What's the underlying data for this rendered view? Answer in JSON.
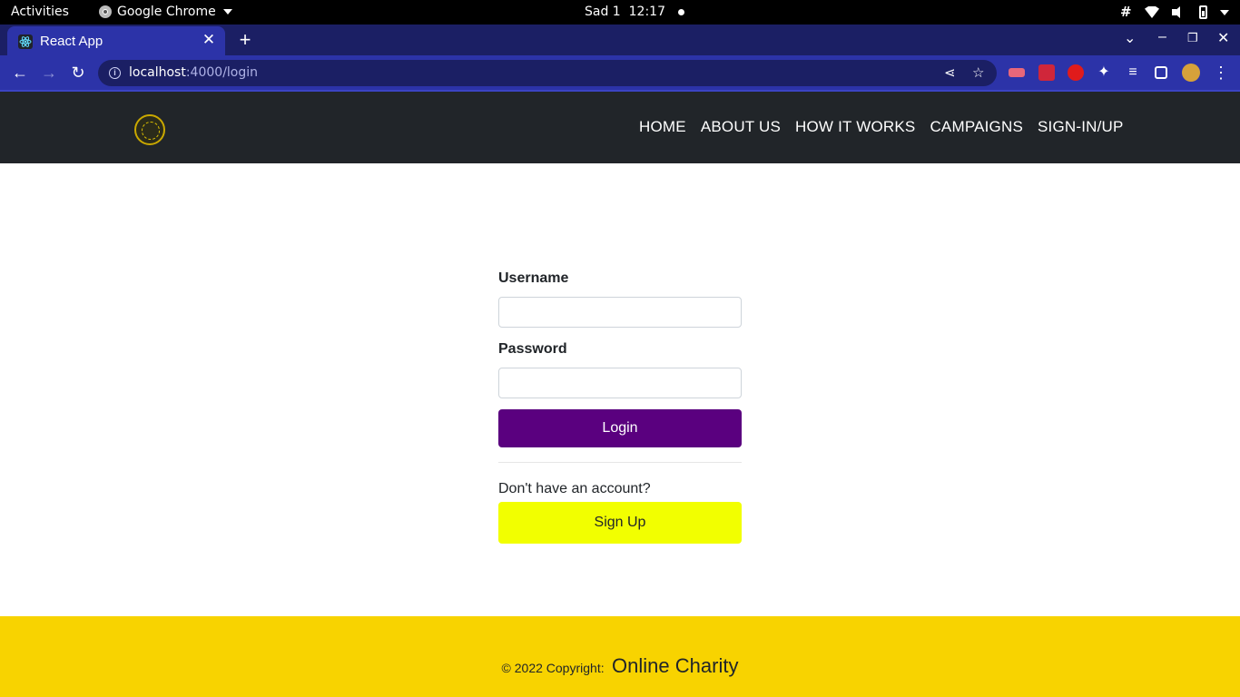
{
  "os_bar": {
    "activities": "Activities",
    "app_name": "Google Chrome",
    "clock_day": "Sad 1",
    "clock_time": "12:17",
    "status_icons": [
      "slack-icon",
      "wifi-icon",
      "volume-icon",
      "battery-icon"
    ]
  },
  "browser": {
    "tab_title": "React App",
    "tab_close": "✕",
    "new_tab": "+",
    "url_host": "localhost",
    "url_path": ":4000/login",
    "tab_color": "#2c33a8",
    "frame_color": "#1b1f64"
  },
  "navbar": {
    "links": [
      "HOME",
      "ABOUT US",
      "HOW IT WORKS",
      "CAMPAIGNS",
      "SIGN-IN/UP"
    ]
  },
  "login_form": {
    "username_label": "Username",
    "username_value": "",
    "password_label": "Password",
    "password_value": "",
    "login_button": "Login",
    "no_account_text": "Don't have an account?",
    "signup_button": "Sign Up",
    "login_color": "#5a007f",
    "signup_color": "#f2ff00"
  },
  "footer": {
    "copyright": "© 2022 Copyright:",
    "brand": "Online Charity",
    "background": "#f8d300"
  }
}
